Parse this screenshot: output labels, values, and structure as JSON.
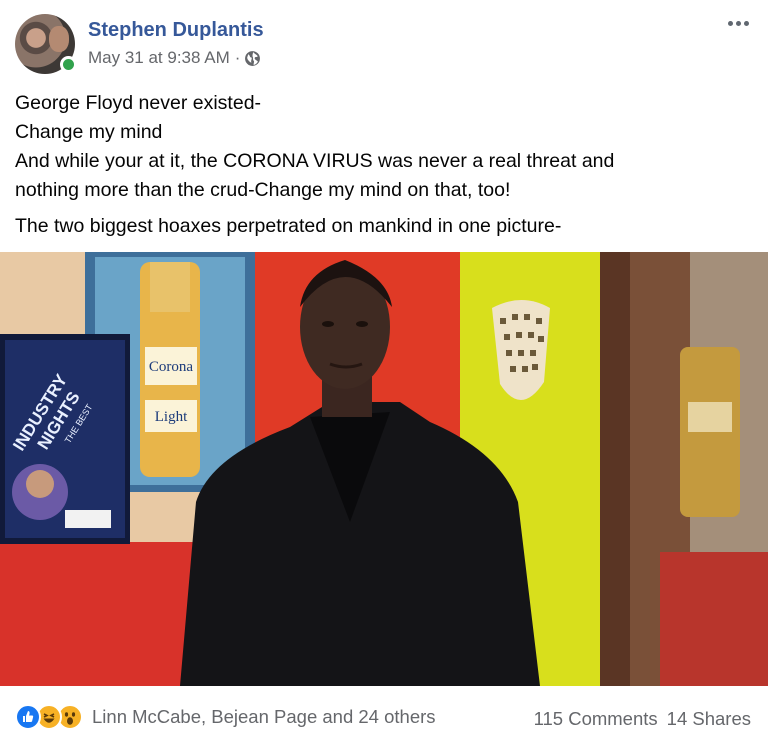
{
  "post": {
    "author": "Stephen Duplantis",
    "timestamp": "May 31 at 9:38 AM",
    "separator": "·",
    "privacy_icon": "globe-icon",
    "lines": [
      "George Floyd never existed-",
      "Change my mind",
      "And while your at it, the CORONA VIRUS was never a real threat and",
      "nothing more than the crud-Change my mind on that, too!"
    ],
    "paragraph2": "The two biggest hoaxes perpetrated on mankind in one picture-"
  },
  "photo": {
    "bottle_label_top": "Corona",
    "bottle_label_bottom": "Light",
    "poster_line1": "INDUSTRY",
    "poster_line2": "NIGHTS",
    "poster_line3": "THE BEST"
  },
  "footer": {
    "reaction_icons": [
      "like-icon",
      "haha-icon",
      "wow-icon"
    ],
    "reactors": "Linn McCabe, Bejean Page and 24 others",
    "comments": "115 Comments",
    "shares": "14 Shares"
  },
  "colors": {
    "author_link": "#365899",
    "muted_text": "#65676b",
    "online": "#31a24c",
    "like_blue": "#1877f2",
    "emoji_yellow": "#f7b125"
  }
}
